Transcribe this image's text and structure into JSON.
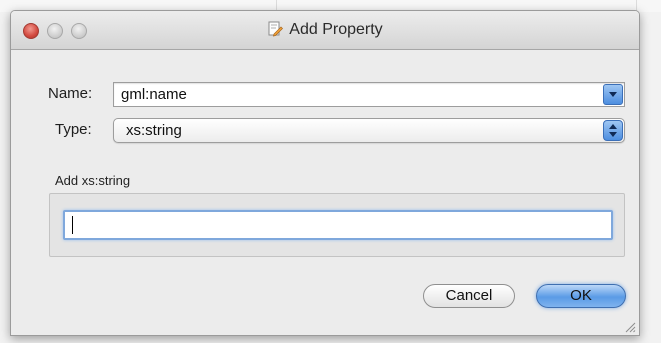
{
  "window": {
    "title": "Add Property",
    "title_icon": "document-pencil-icon",
    "traffic_lights": {
      "close": "#d2493f",
      "minimize": "#c8c8c8",
      "zoom": "#c8c8c8"
    }
  },
  "form": {
    "name_label": "Name:",
    "name_value": "gml:name",
    "type_label": "Type:",
    "type_value": "xs:string"
  },
  "value_group": {
    "label": "Add xs:string",
    "input_value": ""
  },
  "buttons": {
    "cancel_label": "Cancel",
    "ok_label": "OK"
  },
  "colors": {
    "accent": "#5a9be6",
    "focus_ring": "#7fa8dc"
  }
}
